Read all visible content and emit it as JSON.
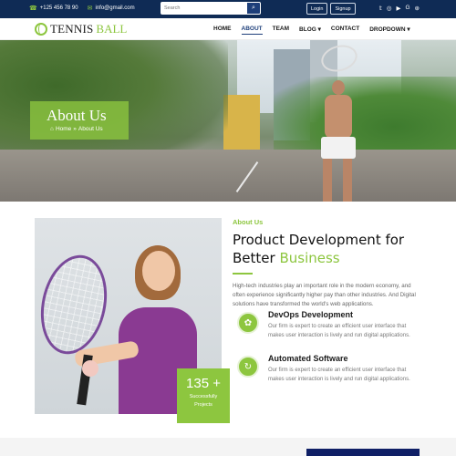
{
  "topbar": {
    "phone": "+125 456 78 90",
    "email": "info@gmail.com",
    "search_placeholder": "Search",
    "login_label": "Login",
    "signup_label": "Signup",
    "social_icons": [
      "twitter-icon",
      "instagram-icon",
      "youtube-icon",
      "google-icon",
      "dribbble-icon"
    ]
  },
  "nav": {
    "logo_part1": "TENNIS",
    "logo_part2": "BALL",
    "items": [
      {
        "label": "HOME"
      },
      {
        "label": "ABOUT"
      },
      {
        "label": "TEAM"
      },
      {
        "label": "BLOG ▾"
      },
      {
        "label": "CONTACT"
      },
      {
        "label": "DROPDOWN ▾"
      }
    ],
    "active": "ABOUT"
  },
  "hero": {
    "title": "About Us",
    "crumb_home": "Home",
    "crumb_sep": "»",
    "crumb_current": "About Us"
  },
  "about": {
    "kicker": "About Us",
    "title_line1": "Product Development for",
    "title_pre": "Better ",
    "title_highlight": "Business",
    "paragraph": "High-tech industries play an important role in the modern economy, and often experience significantly higher pay than other industries. And Digital solutions have transformed the world's web applications.",
    "stat_number": "135 +",
    "stat_label1": "Successfully",
    "stat_label2": "Projects",
    "features": [
      {
        "title": "DevOps Development",
        "desc": "Our firm is expert to create an efficient user interface that makes user interaction is lively and run digital applications.",
        "icon": "devops-icon"
      },
      {
        "title": "Automated Software",
        "desc": "Our firm is expert to create an efficient user interface that makes user interaction is lively and run digital applications.",
        "icon": "automation-icon"
      }
    ]
  },
  "colors": {
    "accent": "#8dc63f",
    "navy": "#0f2b55"
  }
}
